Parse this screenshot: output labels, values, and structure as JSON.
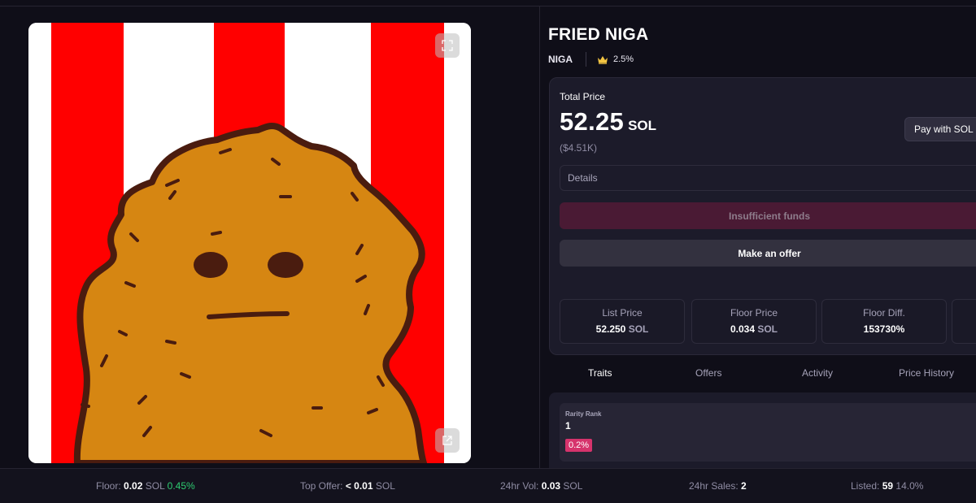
{
  "nft": {
    "name": "FRIED NIGA",
    "collection": "NIGA",
    "royalty": "2.5%",
    "icons": {
      "expand": "expand-icon",
      "open": "external-link-icon",
      "crown": "crown-icon"
    }
  },
  "purchase": {
    "total_label": "Total Price",
    "price": "52.25",
    "currency": "SOL",
    "usd": "($4.51K)",
    "pay_button": "Pay with SOL",
    "details_label": "Details",
    "insufficient_label": "Insufficient funds",
    "offer_label": "Make an offer"
  },
  "stats": [
    {
      "label": "List Price",
      "value": "52.250",
      "unit": "SOL"
    },
    {
      "label": "Floor Price",
      "value": "0.034",
      "unit": "SOL"
    },
    {
      "label": "Floor Diff.",
      "value": "153730%",
      "unit": ""
    }
  ],
  "tabs": [
    "Traits",
    "Offers",
    "Activity",
    "Price History"
  ],
  "active_tab": "Traits",
  "traits": {
    "rarity_label": "Rarity Rank",
    "rarity_value": "1",
    "rarity_pct": "0.2%"
  },
  "footer": {
    "floor_label": "Floor:",
    "floor_value": "0.02",
    "floor_unit": "SOL",
    "floor_change": "0.45%",
    "top_offer_label": "Top Offer:",
    "top_offer_value": "< 0.01",
    "top_offer_unit": "SOL",
    "vol_label": "24hr Vol:",
    "vol_value": "0.03",
    "vol_unit": "SOL",
    "sales_label": "24hr Sales:",
    "sales_value": "2",
    "listed_label": "Listed:",
    "listed_value": "59",
    "listed_pct": "14.0%"
  },
  "colors": {
    "accent_pink": "#d6336c",
    "positive": "#2ecc71",
    "stripe_red": "#ff0000",
    "nugget": "#d68612"
  }
}
